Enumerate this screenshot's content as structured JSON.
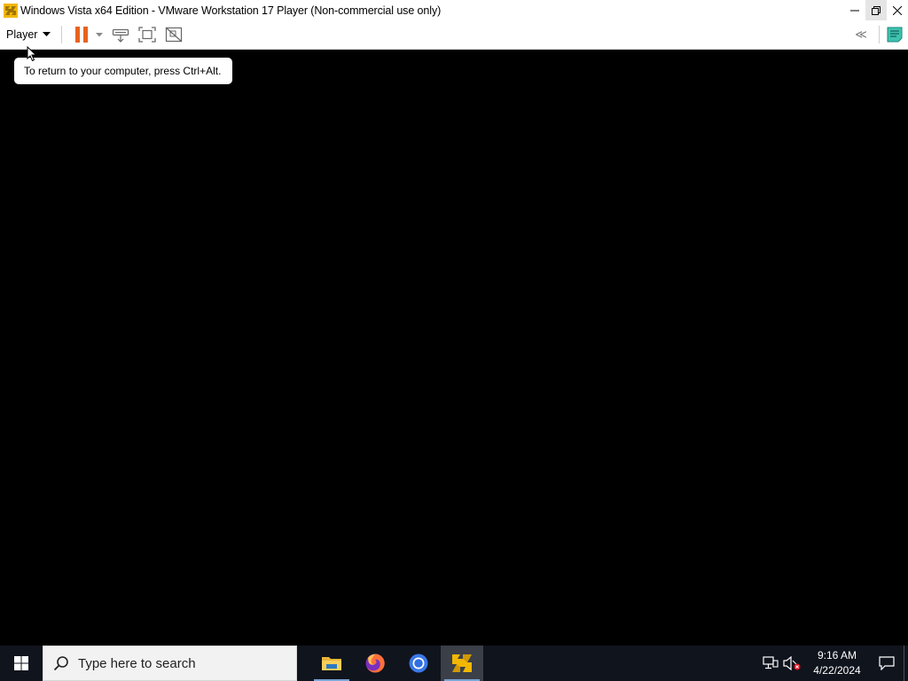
{
  "window": {
    "title": "Windows Vista x64 Edition - VMware Workstation 17 Player (Non-commercial use only)",
    "app_icon": "vmware-player-icon"
  },
  "toolbar": {
    "player_menu_label": "Player",
    "buttons": [
      "pause-icon",
      "send-ctrl-alt-del-icon",
      "fit-guest-icon",
      "unity-mode-icon"
    ],
    "collapse_label": "≪"
  },
  "tooltip": {
    "text": "To return to your computer, press Ctrl+Alt."
  },
  "taskbar": {
    "search_placeholder": "Type here to search",
    "apps": [
      "file-explorer-icon",
      "firefox-icon",
      "chrome-icon",
      "vmware-player-icon"
    ],
    "active_app": "vmware-player-icon",
    "time": "9:16 AM",
    "date": "4/22/2024"
  },
  "colors": {
    "accent_pause": "#e8631d",
    "vmware_yellow": "#f2b705",
    "taskbar_bg": "#10141d"
  }
}
